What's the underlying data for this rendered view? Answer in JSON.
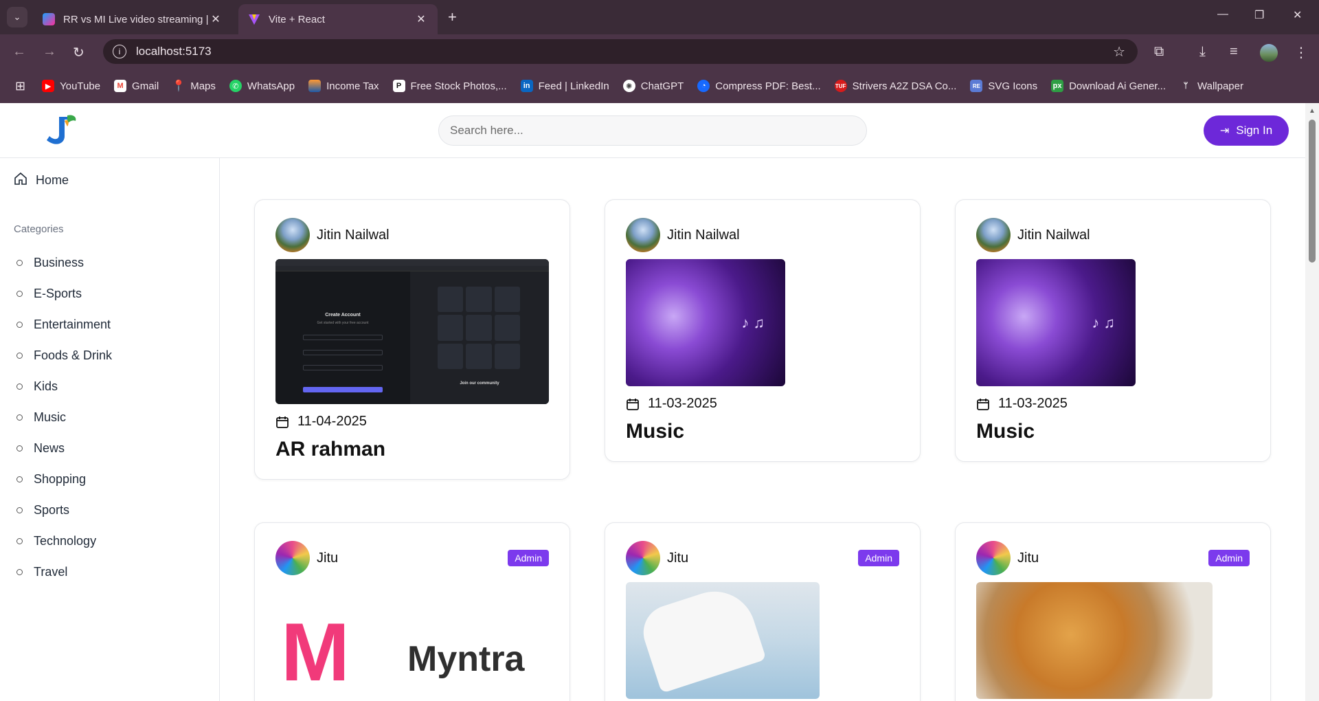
{
  "browser": {
    "tabs": [
      {
        "title": "RR vs MI Live video streaming |",
        "active": false
      },
      {
        "title": "Vite + React",
        "active": true
      }
    ],
    "url": "localhost:5173",
    "bookmarks": [
      {
        "label": "YouTube",
        "icon": "youtube-icon",
        "color": "#ff0000"
      },
      {
        "label": "Gmail",
        "icon": "gmail-icon",
        "color": "#ea4335"
      },
      {
        "label": "Maps",
        "icon": "maps-icon",
        "color": "#34a853"
      },
      {
        "label": "WhatsApp",
        "icon": "whatsapp-icon",
        "color": "#25d366"
      },
      {
        "label": "Income Tax",
        "icon": "income-tax-icon",
        "color": "#1e5aa8"
      },
      {
        "label": "Free Stock Photos,...",
        "icon": "pexels-icon",
        "color": "#111111"
      },
      {
        "label": "Feed | LinkedIn",
        "icon": "linkedin-icon",
        "color": "#0a66c2"
      },
      {
        "label": "ChatGPT",
        "icon": "chatgpt-icon",
        "color": "#444444"
      },
      {
        "label": "Compress PDF: Best...",
        "icon": "compress-pdf-icon",
        "color": "#1769ff"
      },
      {
        "label": "Strivers A2Z DSA Co...",
        "icon": "tuf-icon",
        "color": "#d81b1b"
      },
      {
        "label": "SVG Icons",
        "icon": "svg-icons-icon",
        "color": "#5b7bd5"
      },
      {
        "label": "Download Ai Gener...",
        "icon": "px-icon",
        "color": "#2e9e44"
      },
      {
        "label": "Wallpaper",
        "icon": "wallpaper-icon",
        "color": "#4b3447"
      }
    ]
  },
  "header": {
    "search_placeholder": "Search here...",
    "signin_label": "Sign In"
  },
  "sidebar": {
    "home_label": "Home",
    "categories_heading": "Categories",
    "categories": [
      "Business",
      "E-Sports",
      "Entertainment",
      "Foods & Drink",
      "Kids",
      "Music",
      "News",
      "Shopping",
      "Sports",
      "Technology",
      "Travel"
    ]
  },
  "posts": [
    {
      "author": "Jitin Nailwal",
      "date": "11-04-2025",
      "title": "AR rahman",
      "badge": ""
    },
    {
      "author": "Jitin Nailwal",
      "date": "11-03-2025",
      "title": "Music",
      "badge": ""
    },
    {
      "author": "Jitin Nailwal",
      "date": "11-03-2025",
      "title": "Music",
      "badge": ""
    },
    {
      "author": "Jitu",
      "date": "",
      "title": "",
      "badge": "Admin",
      "image_text": "Myntra"
    },
    {
      "author": "Jitu",
      "date": "",
      "title": "",
      "badge": "Admin"
    },
    {
      "author": "Jitu",
      "date": "",
      "title": "",
      "badge": "Admin"
    }
  ],
  "thumbnail_screenshot": {
    "heading": "Create Account",
    "subheading": "Get started with your free account",
    "side_heading": "Join our community"
  },
  "colors": {
    "accent": "#6d28d9",
    "badge": "#7c3aed",
    "chrome_dark": "#3a2b37",
    "chrome_mid": "#4b3447"
  }
}
